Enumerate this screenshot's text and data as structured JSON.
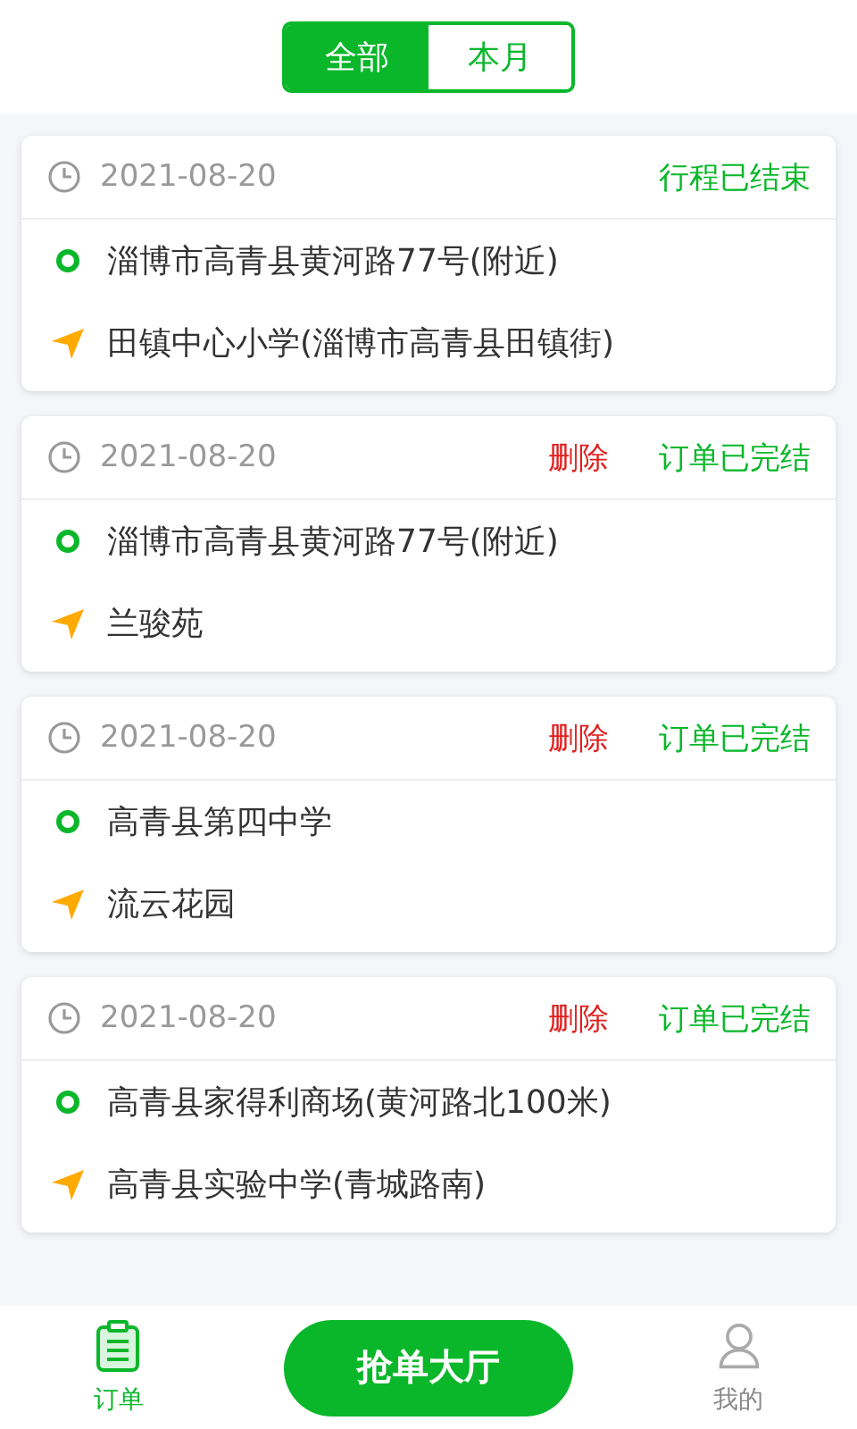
{
  "tabs": [
    {
      "label": "全部",
      "selected": true
    },
    {
      "label": "本月",
      "selected": false
    }
  ],
  "orders": [
    {
      "date": "2021-08-20",
      "status": "行程已结束",
      "from": "淄博市高青县黄河路77号(附近)",
      "to": "田镇中心小学(淄博市高青县田镇街)"
    },
    {
      "date": "2021-08-20",
      "action": "删除",
      "status": "订单已完结",
      "from": "淄博市高青县黄河路77号(附近)",
      "to": "兰骏苑"
    },
    {
      "date": "2021-08-20",
      "action": "删除",
      "status": "订单已完结",
      "from": "高青县第四中学",
      "to": "流云花园"
    },
    {
      "date": "2021-08-20",
      "action": "删除",
      "status": "订单已完结",
      "from": "高青县家得利商场(黄河路北100米)",
      "to": "高青县实验中学(青城路南)"
    }
  ],
  "bottom_nav": [
    {
      "kind": "orders",
      "label": "订单",
      "selected": true
    },
    {
      "kind": "hall",
      "label": "抢单大厅"
    },
    {
      "kind": "profile",
      "label": "我的",
      "selected": false
    }
  ]
}
